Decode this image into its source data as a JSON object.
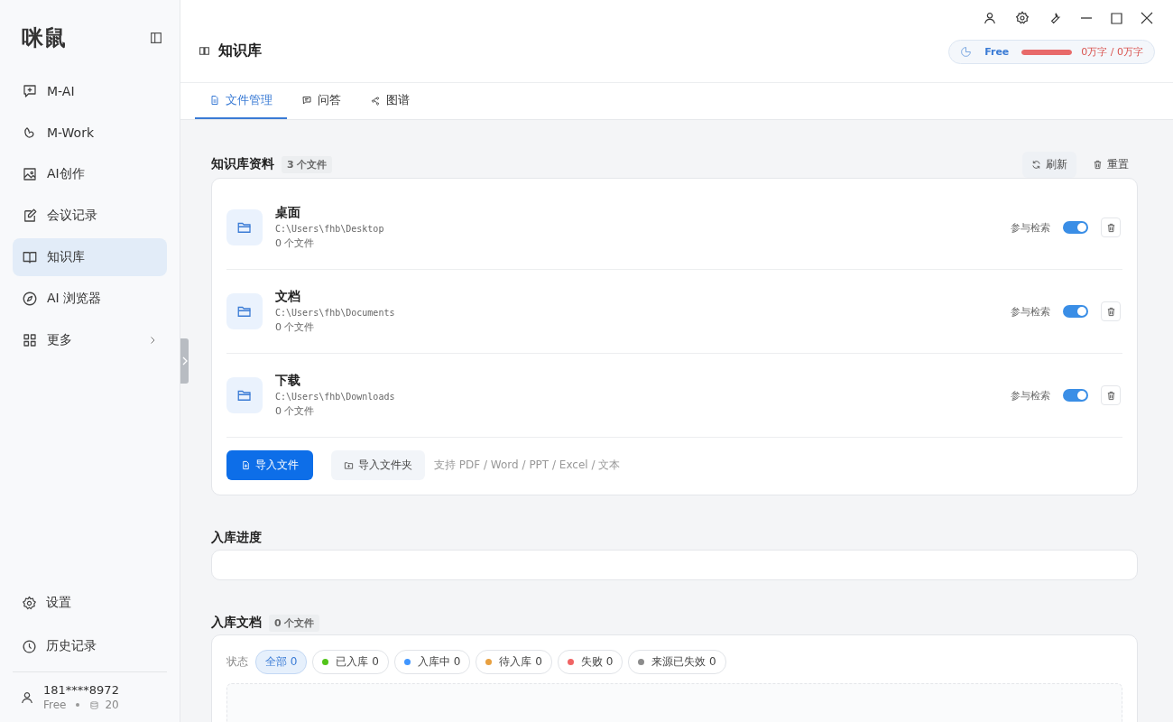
{
  "sidebar": {
    "logo": "咪鼠",
    "items": [
      {
        "label": "M-AI",
        "selected": false,
        "expandable": false
      },
      {
        "label": "M-Work",
        "selected": false,
        "expandable": false
      },
      {
        "label": "AI创作",
        "selected": false,
        "expandable": false
      },
      {
        "label": "会议记录",
        "selected": false,
        "expandable": false
      },
      {
        "label": "知识库",
        "selected": true,
        "expandable": false
      },
      {
        "label": "AI 浏览器",
        "selected": false,
        "expandable": false
      },
      {
        "label": "更多",
        "selected": false,
        "expandable": true
      }
    ],
    "bottom_items": [
      {
        "label": "设置"
      },
      {
        "label": "历史记录"
      }
    ],
    "user": {
      "phone": "181****8972",
      "plan": "Free",
      "credits": "20"
    }
  },
  "header": {
    "title": "知识库",
    "quota": {
      "plan": "Free",
      "level": 1,
      "usage": "0万字 / 0万字"
    }
  },
  "tabs": [
    {
      "label": "文件管理",
      "selected": true
    },
    {
      "label": "问答",
      "selected": false
    },
    {
      "label": "图谱",
      "selected": false
    }
  ],
  "sources": {
    "title": "知识库资料",
    "count": "3 个文件",
    "actions": [
      "刷新",
      "重置"
    ],
    "folders": [
      {
        "name": "桌面",
        "path": "C:\\Users\\fhb\\Desktop",
        "files": "0 个文件",
        "toggle_label": "参与检索",
        "on": true
      },
      {
        "name": "文档",
        "path": "C:\\Users\\fhb\\Documents",
        "files": "0 个文件",
        "toggle_label": "参与检索",
        "on": true
      },
      {
        "name": "下载",
        "path": "C:\\Users\\fhb\\Downloads",
        "files": "0 个文件",
        "toggle_label": "参与检索",
        "on": true
      }
    ],
    "import_file": "导入文件",
    "import_folder": "导入文件夹",
    "hint": "支持 PDF / Word / PPT / Excel / 文本"
  },
  "progress": {
    "title": "入库进度"
  },
  "documents": {
    "title": "入库文档",
    "count": "0 个文件",
    "filter_label": "状态",
    "filters": [
      {
        "label": "全部 0",
        "selected": true
      },
      {
        "label": "已入库 0",
        "selected": false,
        "color": "#52c41a"
      },
      {
        "label": "入库中 0",
        "selected": false,
        "color": "#4096ff"
      },
      {
        "label": "待入库 0",
        "selected": false,
        "color": "#e8a040"
      },
      {
        "label": "失败 0",
        "selected": false,
        "color": "#f06464"
      },
      {
        "label": "来源已失效 0",
        "selected": false,
        "color": "#8c8c8c"
      }
    ]
  }
}
